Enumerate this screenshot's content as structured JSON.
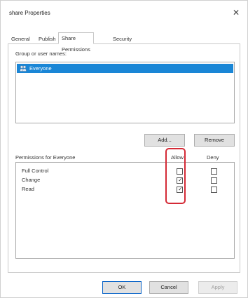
{
  "window": {
    "title": "share Properties",
    "close_glyph": "✕"
  },
  "tabs": [
    {
      "label": "General"
    },
    {
      "label": "Publish"
    },
    {
      "label": "Share Permissions",
      "active": true
    },
    {
      "label": "Security"
    }
  ],
  "groups": {
    "label": "Group or user names:",
    "items": [
      {
        "name": "Everyone",
        "icon": "users-icon",
        "selected": true
      }
    ],
    "add_label": "Add...",
    "remove_label": "Remove"
  },
  "permissions": {
    "label": "Permissions for Everyone",
    "allow_header": "Allow",
    "deny_header": "Deny",
    "rows": [
      {
        "name": "Full Control",
        "allow": false,
        "deny": false
      },
      {
        "name": "Change",
        "allow": true,
        "deny": false
      },
      {
        "name": "Read",
        "allow": true,
        "deny": false
      }
    ]
  },
  "footer": {
    "ok_label": "OK",
    "cancel_label": "Cancel",
    "apply_label": "Apply"
  },
  "colors": {
    "selection": "#1a86d6",
    "highlight": "#d42a36"
  }
}
